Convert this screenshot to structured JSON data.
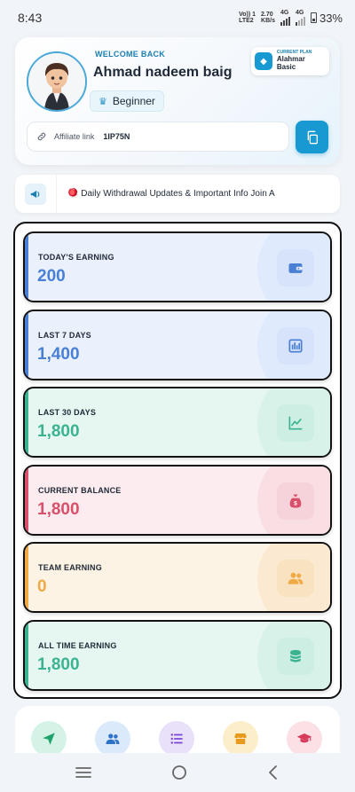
{
  "status_bar": {
    "time": "8:43",
    "volte_top": "Vo)) 1",
    "volte_bottom": "LTE2",
    "speed_value": "2.70",
    "speed_unit": "KB/s",
    "net1": "4G",
    "net2": "4G",
    "battery": "33%"
  },
  "profile": {
    "welcome": "WELCOME BACK",
    "name": "Ahmad nadeem baig",
    "rank": "Beginner",
    "plan_label": "CURRENT PLAN",
    "plan_name": "Alahmar Basic",
    "affiliate_label": "Affiliate link",
    "affiliate_code": "1IP75N"
  },
  "announcement": {
    "text": "🪀 Daily Withdrawal Updates & Important Info Join A"
  },
  "stats": [
    {
      "label": "TODAY'S EARNING",
      "value": "200",
      "icon": "wallet-icon",
      "accent": "#4a7fd6",
      "bg": "#eaf1fd",
      "blob": "#dfeafc",
      "icon_bg": "#d6e3fb"
    },
    {
      "label": "LAST 7 DAYS",
      "value": "1,400",
      "icon": "bar-chart-icon",
      "accent": "#4a7fd6",
      "bg": "#eaf1fd",
      "blob": "#dfeafc",
      "icon_bg": "#d6e3fb"
    },
    {
      "label": "LAST 30 DAYS",
      "value": "1,800",
      "icon": "trend-chart-icon",
      "accent": "#3bb391",
      "bg": "#e6f7f1",
      "blob": "#d8f2e9",
      "icon_bg": "#cdeee2"
    },
    {
      "label": "CURRENT BALANCE",
      "value": "1,800",
      "icon": "money-bag-icon",
      "accent": "#d9506a",
      "bg": "#fcecef",
      "blob": "#f9dfe4",
      "icon_bg": "#f6d3da"
    },
    {
      "label": "TEAM EARNING",
      "value": "0",
      "icon": "team-icon",
      "accent": "#efaa46",
      "bg": "#fdf3e4",
      "blob": "#fbead1",
      "icon_bg": "#f9e2bf"
    },
    {
      "label": "ALL TIME EARNING",
      "value": "1,800",
      "icon": "coins-icon",
      "accent": "#3bb391",
      "bg": "#e6f7f1",
      "blob": "#d8f2e9",
      "icon_bg": "#cdeee2"
    }
  ],
  "bottom_nav": [
    {
      "icon": "send-icon",
      "bg": "#d4f3e6",
      "color": "#1fa36c"
    },
    {
      "icon": "users-icon",
      "bg": "#dbeafb",
      "color": "#2d72c6"
    },
    {
      "icon": "list-icon",
      "bg": "#e9e0fa",
      "color": "#7b48d6"
    },
    {
      "icon": "store-icon",
      "bg": "#fdeecb",
      "color": "#e79a1e"
    },
    {
      "icon": "graduation-cap-icon",
      "bg": "#fbe0e6",
      "color": "#d83a5c"
    }
  ]
}
